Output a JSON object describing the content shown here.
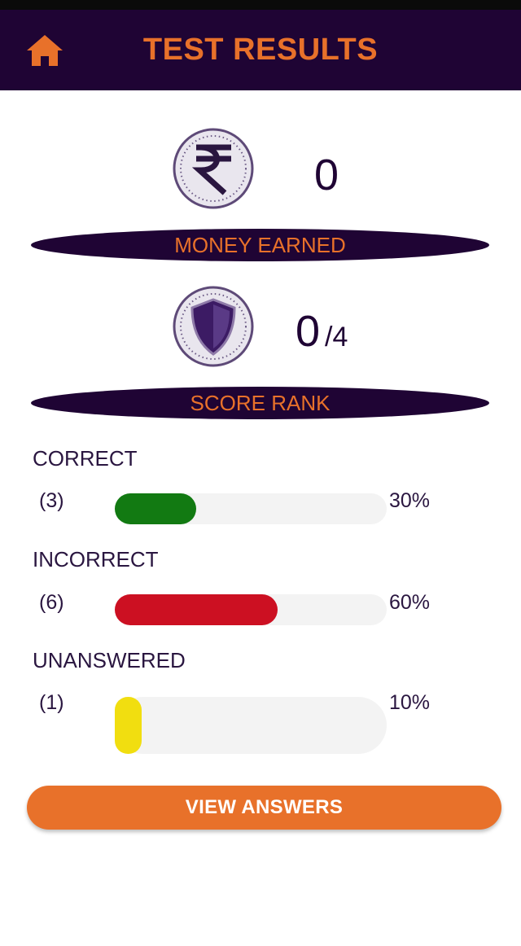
{
  "header": {
    "title": "TEST RESULTS",
    "home_icon": "home-icon",
    "accent_color": "#e8712a",
    "bar_color": "#1f0434"
  },
  "money": {
    "icon": "rupee-coin-icon",
    "value": "0",
    "label": "MONEY EARNED"
  },
  "rank": {
    "icon": "shield-badge-icon",
    "value": "0",
    "total": "/4",
    "label": "SCORE RANK"
  },
  "stats": [
    {
      "label": "CORRECT",
      "count": "(3)",
      "percent_text": "30%",
      "fraction": 0.3,
      "color": "#127a12"
    },
    {
      "label": "INCORRECT",
      "count": "(6)",
      "percent_text": "60%",
      "fraction": 0.6,
      "color": "#cc1022"
    },
    {
      "label": "UNANSWERED",
      "count": "(1)",
      "percent_text": "10%",
      "fraction": 0.1,
      "color": "#f1de10"
    }
  ],
  "actions": {
    "view_answers_label": "VIEW ANSWERS"
  }
}
